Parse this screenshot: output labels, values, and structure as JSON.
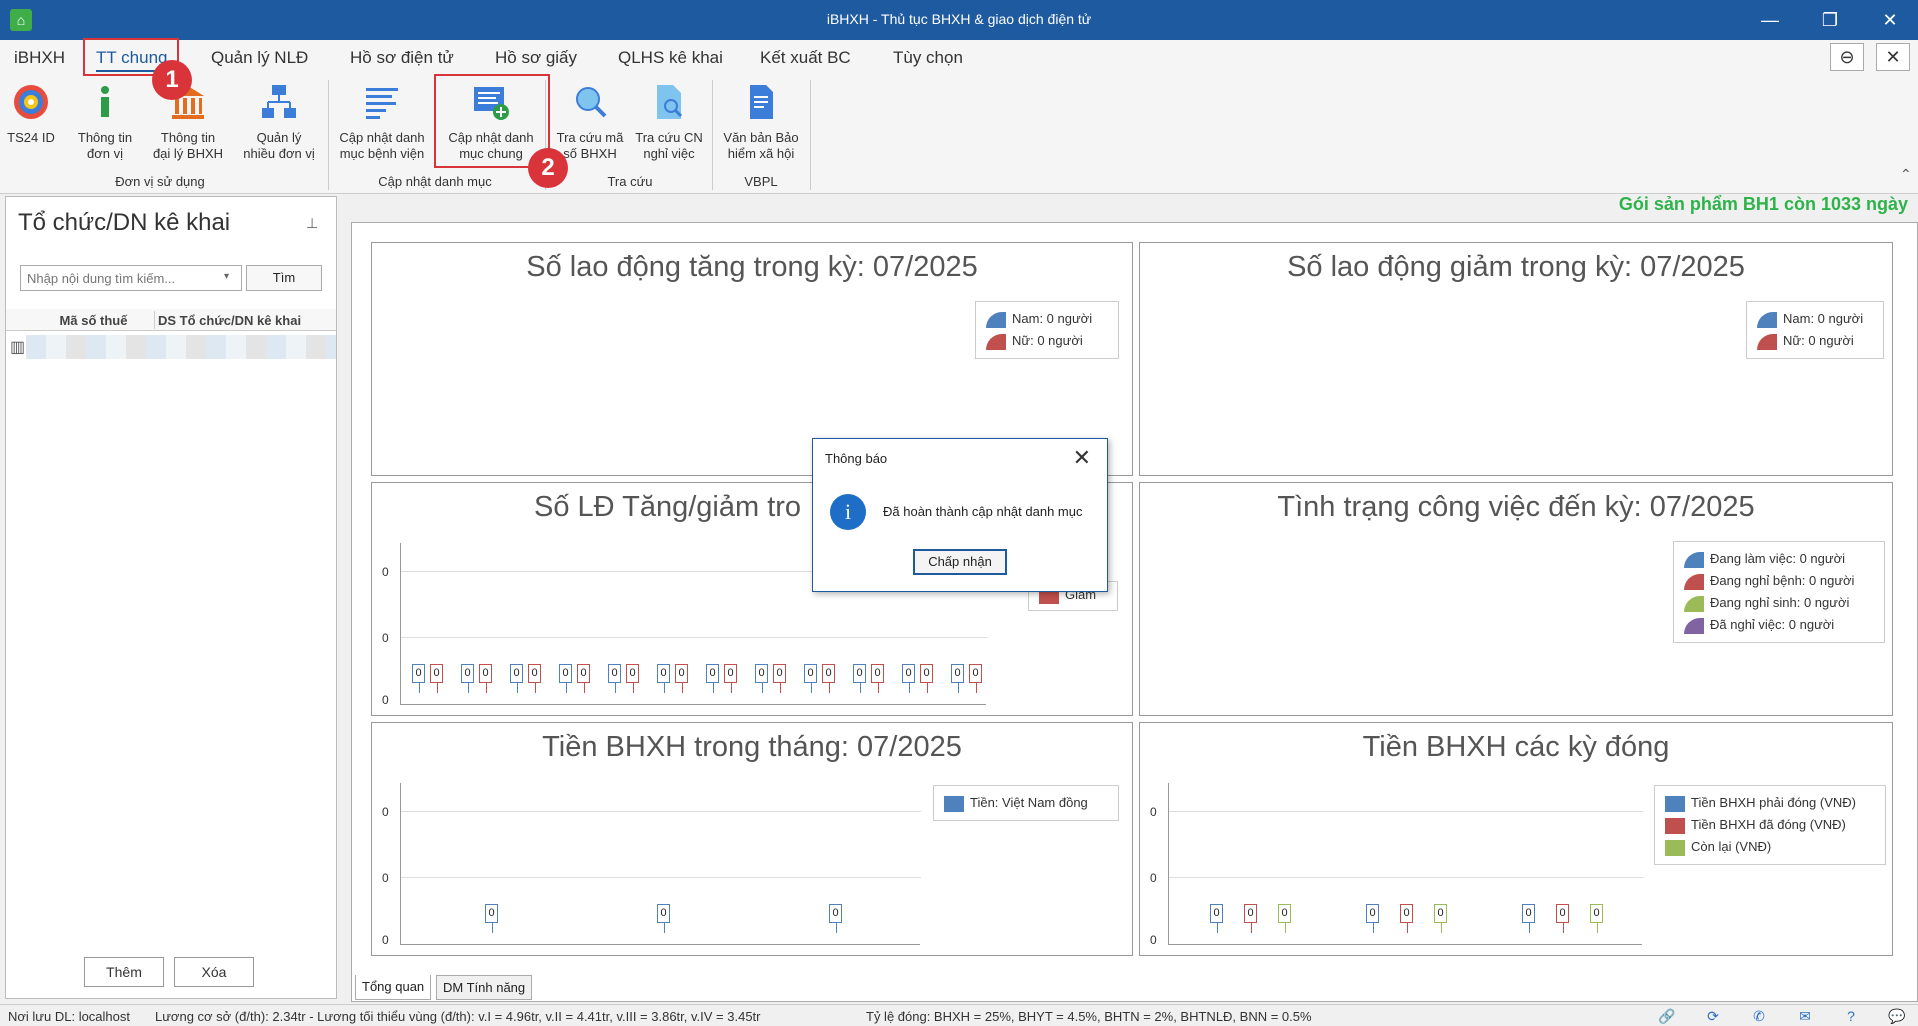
{
  "window": {
    "title": "iBHXH - Thủ tục BHXH & giao dịch điện tử",
    "minimize": "—",
    "restore": "❐",
    "close": "✕"
  },
  "menu": {
    "items": [
      "iBHXH",
      "TT chung",
      "Quản lý NLĐ",
      "Hồ sơ điện tử",
      "Hồ sơ giấy",
      "QLHS kê khai",
      "Kết xuất BC",
      "Tùy chọn"
    ],
    "active": "TT chung",
    "minimize_btn": "⊖",
    "close_btn": "✕"
  },
  "annotations": {
    "step1": "1",
    "step2": "2"
  },
  "ribbon": {
    "buttons": [
      {
        "id": "ts24",
        "label1": "TS24 ID",
        "label2": "",
        "icon": "ts24-logo-icon"
      },
      {
        "id": "thongtin-donvi",
        "label1": "Thông tin",
        "label2": "đơn vị",
        "icon": "info-icon"
      },
      {
        "id": "thongtin-daily",
        "label1": "Thông tin",
        "label2": "đại lý BHXH",
        "icon": "building-icon"
      },
      {
        "id": "quanly-donvi",
        "label1": "Quản lý",
        "label2": "nhiều đơn vị",
        "icon": "network-icon"
      },
      {
        "id": "capnhat-benhvien",
        "label1": "Cập nhật danh",
        "label2": "mục bệnh viện",
        "icon": "list-icon"
      },
      {
        "id": "capnhat-chung",
        "label1": "Cập nhật danh",
        "label2": "mục chung",
        "icon": "list-add-icon"
      },
      {
        "id": "tracuu-ma",
        "label1": "Tra cứu mã",
        "label2": "số BHXH",
        "icon": "search-icon"
      },
      {
        "id": "tracuu-cn",
        "label1": "Tra cứu CN",
        "label2": "nghỉ việc",
        "icon": "doc-search-icon"
      },
      {
        "id": "vanban",
        "label1": "Văn bản Bảo",
        "label2": "hiểm xã hội",
        "icon": "document-icon"
      }
    ],
    "groups": [
      "Đơn vị sử dụng",
      "Cập nhật danh mục",
      "Tra cứu",
      "VBPL"
    ]
  },
  "left_panel": {
    "title": "Tổ chức/DN kê khai",
    "pin": "⊥",
    "search_placeholder": "Nhập nội dung tìm kiếm...",
    "search_button": "Tìm",
    "col1": "Mã số thuế",
    "col2": "DS Tổ chức/DN kê khai",
    "add_button": "Thêm",
    "delete_button": "Xóa"
  },
  "product_notice": "Gói sản phẩm BH1 còn 1033 ngày",
  "cards": {
    "tang": {
      "title": "Số lao động tăng trong kỳ: 07/2025",
      "legend": [
        "Nam: 0 người",
        "Nữ: 0 người"
      ]
    },
    "giam": {
      "title": "Số lao động giảm trong kỳ: 07/2025",
      "legend": [
        "Nam: 0 người",
        "Nữ: 0 người"
      ]
    },
    "tanggiam": {
      "title": "Số LĐ Tăng/giảm tro",
      "legend_partial": "Giảm",
      "y_labels": [
        "0",
        "0",
        "0"
      ],
      "bar_label": "0"
    },
    "tinhtrang": {
      "title": "Tình trạng công việc đến kỳ: 07/2025",
      "legend": [
        "Đang làm việc: 0 người",
        "Đang nghỉ bệnh: 0 người",
        "Đang nghỉ sinh: 0 người",
        "Đã nghỉ việc: 0 người"
      ]
    },
    "tienthang": {
      "title": "Tiền BHXH trong tháng: 07/2025",
      "legend": [
        "Tiền: Việt Nam đồng"
      ],
      "y_labels": [
        "0",
        "0",
        "0"
      ],
      "bar_label": "0"
    },
    "tienky": {
      "title": "Tiền BHXH các kỳ đóng",
      "legend": [
        "Tiền BHXH phải đóng (VNĐ)",
        "Tiền BHXH đã đóng (VNĐ)",
        "Còn lại (VNĐ)"
      ],
      "y_labels": [
        "0",
        "0",
        "0"
      ],
      "bar_label": "0"
    }
  },
  "colors": {
    "blue": "#4f81bd",
    "red": "#c0504d",
    "green": "#9bbb59",
    "purple": "#8064a2"
  },
  "tabs": [
    "Tổng quan",
    "DM Tính năng"
  ],
  "dialog": {
    "title": "Thông báo",
    "message": "Đã hoàn thành cập nhật danh mục",
    "button": "Chấp nhận",
    "icon_glyph": "i",
    "close": "✕"
  },
  "status": {
    "storage": "Nơi lưu DL: localhost",
    "salary": "Lương cơ sở (đ/th): 2.34tr - Lương tối thiểu vùng (đ/th): v.I = 4.96tr, v.II = 4.41tr, v.III = 3.86tr, v.IV = 3.45tr",
    "rates": "Tỷ lệ đóng: BHXH = 25%, BHYT = 4.5%, BHTN = 2%, BHTNLĐ, BNN = 0.5%",
    "icons": [
      "link-icon",
      "sync-icon",
      "phone-icon",
      "mail-icon",
      "help-icon",
      "chat-icon"
    ]
  }
}
